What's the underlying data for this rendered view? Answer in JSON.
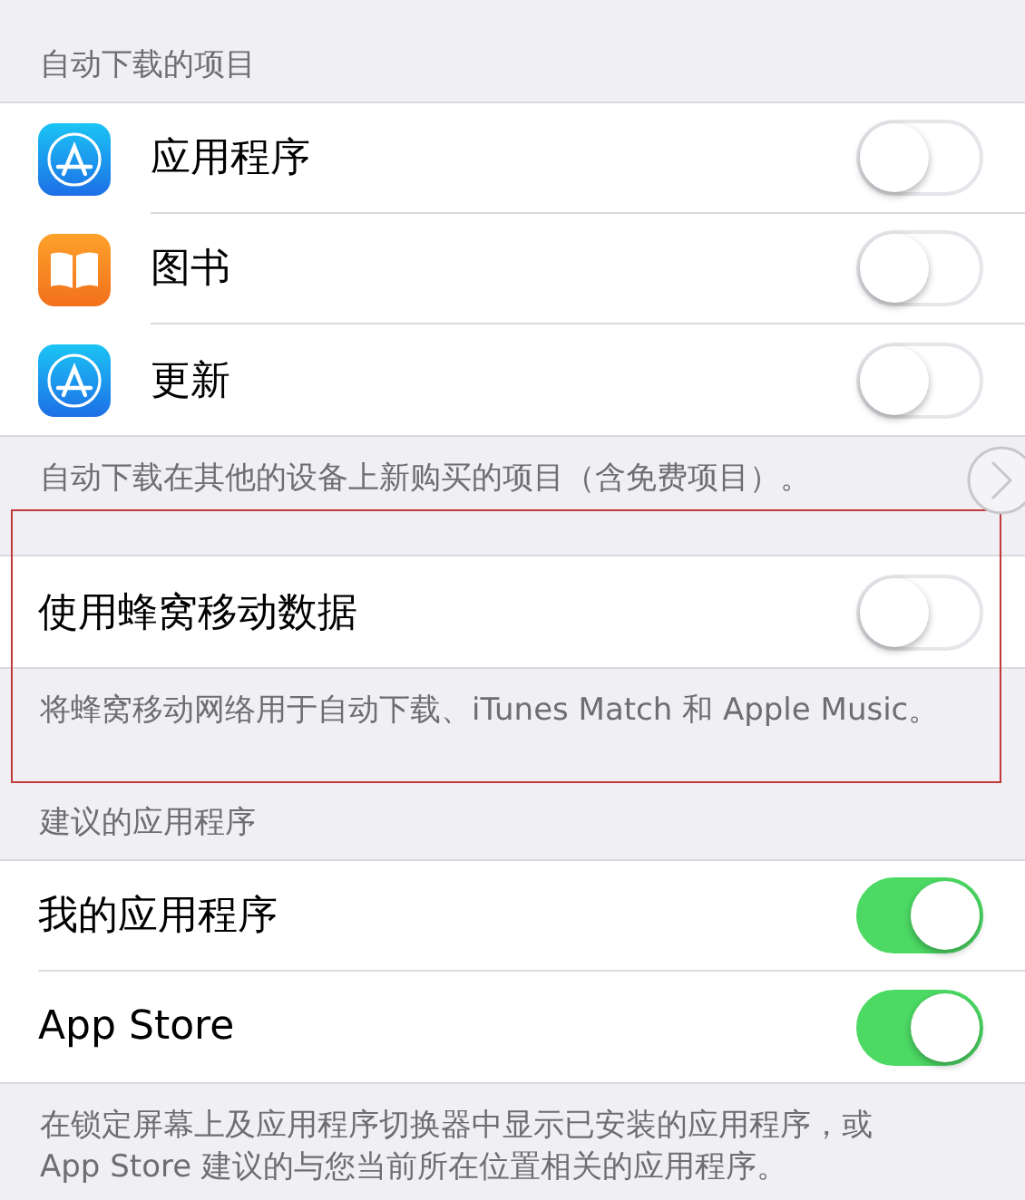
{
  "sections": [
    {
      "header": "自动下载的项目",
      "highlighted": false,
      "rows": [
        {
          "kind": "app",
          "label": "应用程序",
          "on": false
        },
        {
          "kind": "books",
          "label": "图书",
          "on": false
        },
        {
          "kind": "app",
          "label": "更新",
          "on": false
        }
      ],
      "footer_lines": [
        "自动下载在其他的设备上新购买的项目（含免费项目）。"
      ]
    },
    {
      "highlighted": true,
      "rows": [
        {
          "kind": "plain",
          "label": "使用蜂窝移动数据",
          "on": false
        }
      ],
      "footer_lines": [
        "将蜂窝移动网络用于自动下载、iTunes Match 和 Apple Music。"
      ]
    },
    {
      "header": "建议的应用程序",
      "highlighted": false,
      "rows": [
        {
          "kind": "plain",
          "label": "我的应用程序",
          "on": true
        },
        {
          "kind": "plain",
          "label": "App Store",
          "on": true
        }
      ],
      "footer_lines": [
        "在锁定屏幕上及应用程序切换器中显示已安装的应用程序，或",
        "App Store 建议的与您当前所在位置相关的应用程序。"
      ]
    }
  ]
}
